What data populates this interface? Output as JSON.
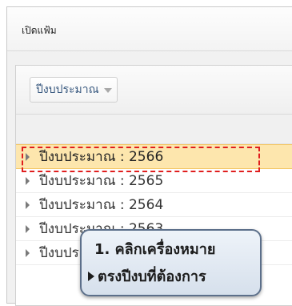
{
  "window": {
    "title": "เปิดแฟ้ม"
  },
  "toolbar": {
    "group_label": "ปีงบประมาณ"
  },
  "list": {
    "items": [
      {
        "label": "ปีงบประมาณ : 2566",
        "selected": true
      },
      {
        "label": "ปีงบประมาณ : 2565",
        "selected": false
      },
      {
        "label": "ปีงบประมาณ : 2564",
        "selected": false
      },
      {
        "label": "ปีงบประมาณ : 2563",
        "selected": false
      },
      {
        "label": "ปีงบประมาณ : 2562",
        "selected": false
      }
    ]
  },
  "callout": {
    "line1": "1. คลิกเครื่องหมาย",
    "line2": "ตรงปีงบที่ต้องการ"
  },
  "colors": {
    "selection": "#fde6ad",
    "highlight_border": "#e01e1e",
    "callout_border": "#5c6f8a"
  }
}
